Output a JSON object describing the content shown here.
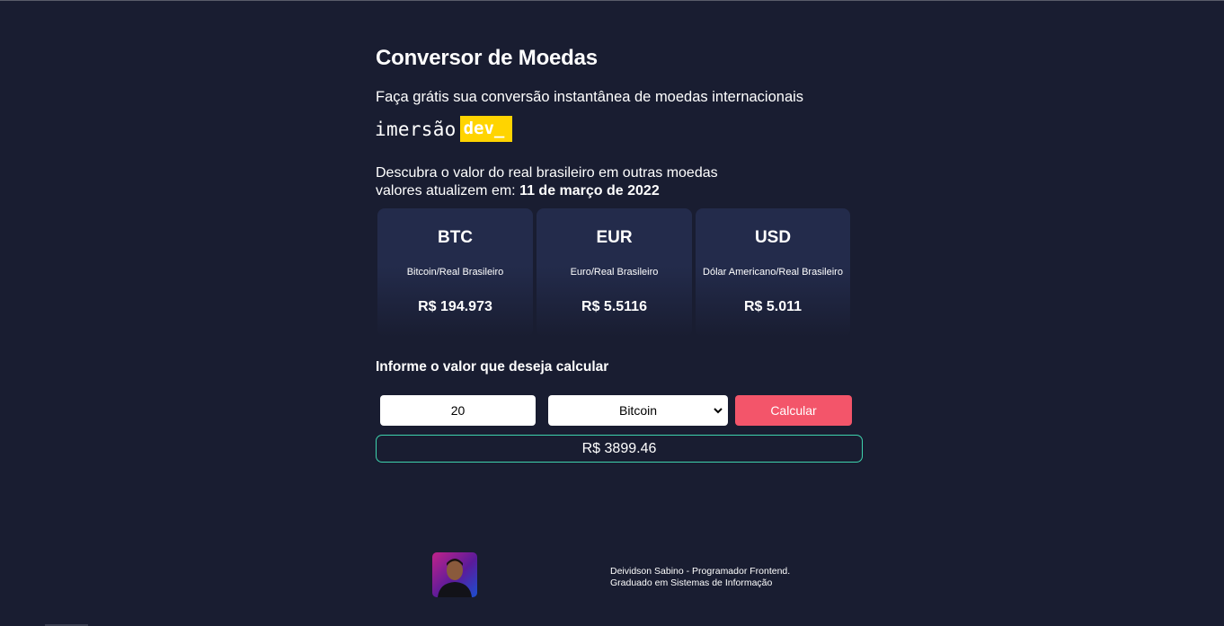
{
  "header": {
    "title": "Conversor de Moedas",
    "subtitle": "Faça grátis sua conversão instantânea de moedas internacionais"
  },
  "logo": {
    "imersao": "imersão",
    "dev": "dev_"
  },
  "info": {
    "line1": "Descubra o valor do real brasileiro em outras moedas",
    "line2_prefix": "valores atualizem em: ",
    "date": "11 de março de 2022"
  },
  "cards": [
    {
      "code": "BTC",
      "name": "Bitcoin/Real Brasileiro",
      "value": "R$ 194.973"
    },
    {
      "code": "EUR",
      "name": "Euro/Real Brasileiro",
      "value": "R$ 5.5116"
    },
    {
      "code": "USD",
      "name": "Dólar Americano/Real Brasileiro",
      "value": "R$ 5.011"
    }
  ],
  "form": {
    "label": "Informe o valor que deseja calcular",
    "amount": "20",
    "selected_currency": "Bitcoin",
    "button_label": "Calcular",
    "result": "R$ 3899.46"
  },
  "footer": {
    "line1": "Deividson Sabino - Programador Frontend.",
    "line2": "Graduado em Sistemas de Informação"
  },
  "colors": {
    "background": "#191d31",
    "card": "#232b4b",
    "accent_yellow": "#ffd400",
    "button": "#f3556a",
    "result_border": "#3ed3ad"
  }
}
